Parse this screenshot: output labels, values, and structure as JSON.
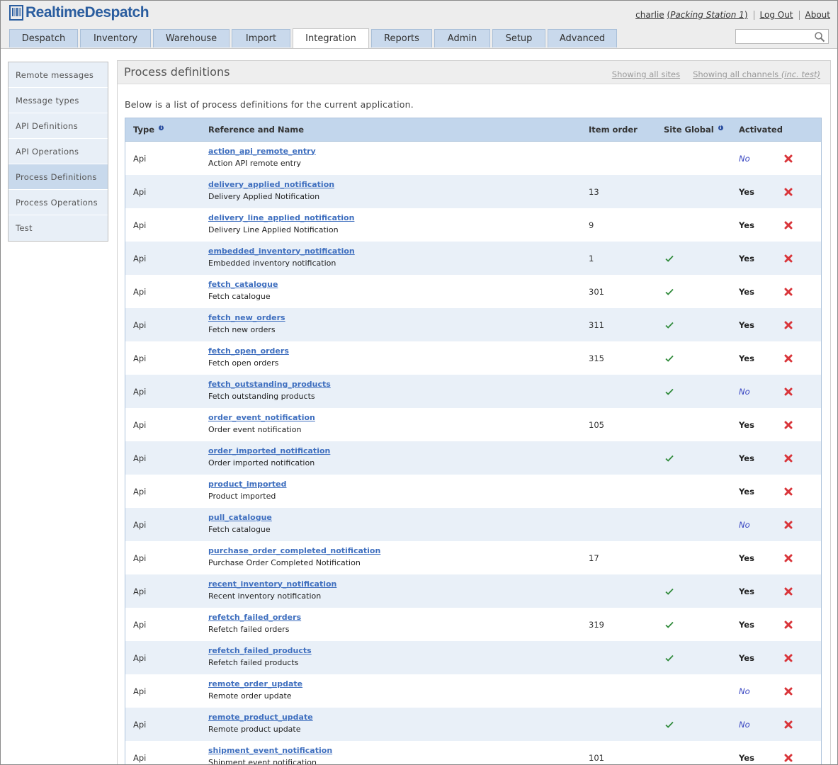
{
  "app": {
    "logo": "RealtimeDespatch"
  },
  "user": {
    "name": "charlie",
    "station_open": "(",
    "station": "Packing Station 1",
    "station_close": ")",
    "logout": "Log Out",
    "about": "About"
  },
  "tabs": [
    {
      "label": "Despatch",
      "w": 97
    },
    {
      "label": "Inventory",
      "w": 100
    },
    {
      "label": "Warehouse",
      "w": 108
    },
    {
      "label": "Import",
      "w": 83
    },
    {
      "label": "Integration",
      "w": 108
    },
    {
      "label": "Reports",
      "w": 86
    },
    {
      "label": "Admin",
      "w": 79
    },
    {
      "label": "Setup",
      "w": 75
    },
    {
      "label": "Advanced",
      "w": 98
    }
  ],
  "active_tab": "Integration",
  "search": {
    "placeholder": ""
  },
  "sidebar": {
    "items": [
      {
        "label": "Remote messages"
      },
      {
        "label": "Message types"
      },
      {
        "label": "API Definitions"
      },
      {
        "label": "API Operations"
      },
      {
        "label": "Process Definitions"
      },
      {
        "label": "Process Operations"
      },
      {
        "label": "Test"
      }
    ],
    "active": "Process Definitions"
  },
  "content": {
    "title": "Process definitions",
    "showing_sites": "Showing all sites",
    "showing_channels": "Showing all channels",
    "inc_test": "(inc. test)",
    "intro": "Below is a list of process definitions for the current application."
  },
  "table": {
    "headers": {
      "type": "Type",
      "reference": "Reference and Name",
      "item_order": "Item order",
      "site_global": "Site Global",
      "activated": "Activated"
    },
    "rows": [
      {
        "type": "Api",
        "ref": "action_api_remote_entry",
        "name": "Action API remote entry",
        "order": "",
        "global": false,
        "activated": "No"
      },
      {
        "type": "Api",
        "ref": "delivery_applied_notification",
        "name": "Delivery Applied Notification",
        "order": "13",
        "global": false,
        "activated": "Yes"
      },
      {
        "type": "Api",
        "ref": "delivery_line_applied_notification",
        "name": "Delivery Line Applied Notification",
        "order": "9",
        "global": false,
        "activated": "Yes"
      },
      {
        "type": "Api",
        "ref": "embedded_inventory_notification",
        "name": "Embedded inventory notification",
        "order": "1",
        "global": true,
        "activated": "Yes"
      },
      {
        "type": "Api",
        "ref": "fetch_catalogue",
        "name": "Fetch catalogue",
        "order": "301",
        "global": true,
        "activated": "Yes"
      },
      {
        "type": "Api",
        "ref": "fetch_new_orders",
        "name": "Fetch new orders",
        "order": "311",
        "global": true,
        "activated": "Yes"
      },
      {
        "type": "Api",
        "ref": "fetch_open_orders",
        "name": "Fetch open orders",
        "order": "315",
        "global": true,
        "activated": "Yes"
      },
      {
        "type": "Api",
        "ref": "fetch_outstanding_products",
        "name": "Fetch outstanding products",
        "order": "",
        "global": true,
        "activated": "No"
      },
      {
        "type": "Api",
        "ref": "order_event_notification",
        "name": "Order event notification",
        "order": "105",
        "global": false,
        "activated": "Yes"
      },
      {
        "type": "Api",
        "ref": "order_imported_notification",
        "name": "Order imported notification",
        "order": "",
        "global": true,
        "activated": "Yes"
      },
      {
        "type": "Api",
        "ref": "product_imported",
        "name": "Product imported",
        "order": "",
        "global": false,
        "activated": "Yes"
      },
      {
        "type": "Api",
        "ref": "pull_catalogue",
        "name": "Fetch catalogue",
        "order": "",
        "global": false,
        "activated": "No"
      },
      {
        "type": "Api",
        "ref": "purchase_order_completed_notification",
        "name": "Purchase Order Completed Notification",
        "order": "17",
        "global": false,
        "activated": "Yes"
      },
      {
        "type": "Api",
        "ref": "recent_inventory_notification",
        "name": "Recent inventory notification",
        "order": "",
        "global": true,
        "activated": "Yes"
      },
      {
        "type": "Api",
        "ref": "refetch_failed_orders",
        "name": "Refetch failed orders",
        "order": "319",
        "global": true,
        "activated": "Yes"
      },
      {
        "type": "Api",
        "ref": "refetch_failed_products",
        "name": "Refetch failed products",
        "order": "",
        "global": true,
        "activated": "Yes"
      },
      {
        "type": "Api",
        "ref": "remote_order_update",
        "name": "Remote order update",
        "order": "",
        "global": false,
        "activated": "No"
      },
      {
        "type": "Api",
        "ref": "remote_product_update",
        "name": "Remote product update",
        "order": "",
        "global": true,
        "activated": "No"
      },
      {
        "type": "Api",
        "ref": "shipment_event_notification",
        "name": "Shipment event notification",
        "order": "101",
        "global": false,
        "activated": "Yes"
      }
    ]
  },
  "colors": {
    "link": "#3f6fbf",
    "header_bg": "#c2d6ec",
    "row_alt": "#e9f0f8",
    "check": "#2f8a3a",
    "delete": "#d9353a",
    "no_text": "#3a47c2"
  }
}
